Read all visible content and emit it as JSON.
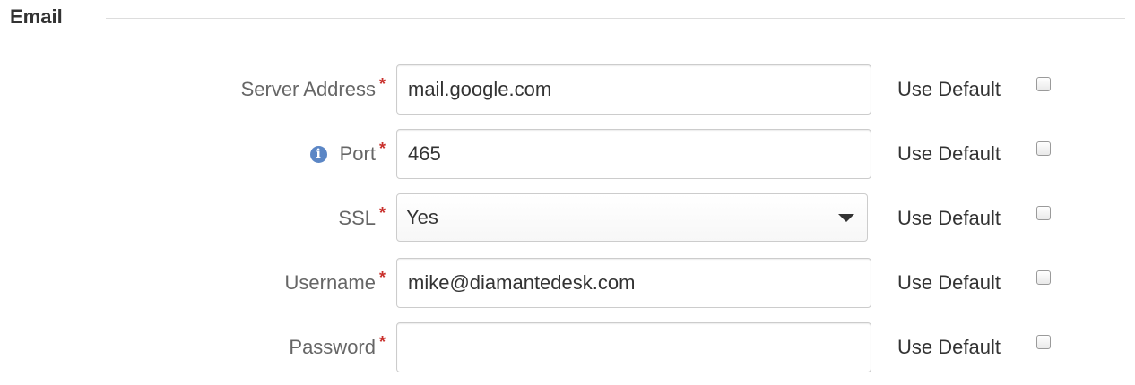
{
  "section": {
    "title": "Email"
  },
  "fields": {
    "server_address": {
      "label": "Server Address",
      "required_mark": "*",
      "value": "mail.google.com",
      "use_default_label": "Use Default",
      "use_default_checked": false
    },
    "port": {
      "label": "Port",
      "required_mark": "*",
      "info_icon_glyph": "i",
      "icon": "info-icon",
      "value": "465",
      "use_default_label": "Use Default",
      "use_default_checked": false
    },
    "ssl": {
      "label": "SSL",
      "required_mark": "*",
      "selected": "Yes",
      "icon": "caret-down-icon",
      "use_default_label": "Use Default",
      "use_default_checked": false
    },
    "username": {
      "label": "Username",
      "required_mark": "*",
      "value": "mike@diamantedesk.com",
      "use_default_label": "Use Default",
      "use_default_checked": false
    },
    "password": {
      "label": "Password",
      "required_mark": "*",
      "value": "",
      "use_default_label": "Use Default",
      "use_default_checked": false
    }
  },
  "colors": {
    "required_star": "#c9302c",
    "info_icon": "#5b86c5",
    "label_text": "#666666",
    "input_border": "#cccccc"
  }
}
